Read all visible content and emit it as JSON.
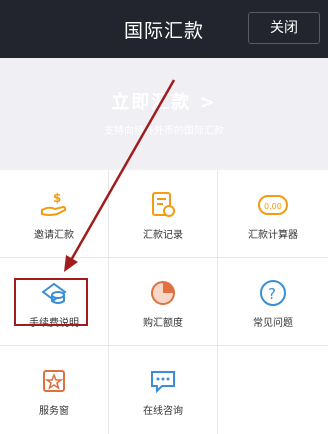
{
  "header": {
    "title": "国际汇款",
    "close_label": "关闭"
  },
  "banner": {
    "title": "立即汇款 >",
    "subtitle": "支持向境外外币的国际汇款"
  },
  "grid": {
    "items": [
      {
        "label": "邀请汇款",
        "icon": "hand-money-icon"
      },
      {
        "label": "汇款记录",
        "icon": "record-icon"
      },
      {
        "label": "汇款计算器",
        "icon": "calculator-icon"
      },
      {
        "label": "手续费说明",
        "icon": "fee-coins-icon"
      },
      {
        "label": "购汇额度",
        "icon": "quota-pie-icon"
      },
      {
        "label": "常见问题",
        "icon": "question-icon"
      },
      {
        "label": "服务窗",
        "icon": "star-window-icon"
      },
      {
        "label": "在线咨询",
        "icon": "chat-icon"
      }
    ]
  },
  "colors": {
    "accent": "#f39c12",
    "blue": "#3a8fd6",
    "header": "#22252d",
    "annotation": "#a11d1d"
  }
}
